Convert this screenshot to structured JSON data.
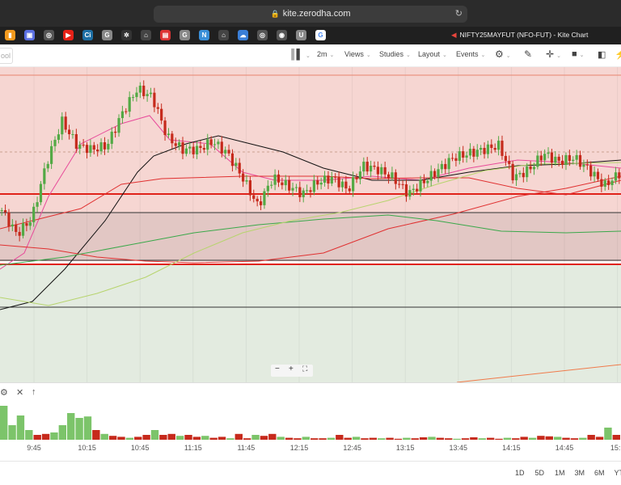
{
  "browser": {
    "url": "kite.zerodha.com",
    "tab_title": "NIFTY25MAYFUT (NFO-FUT) - Kite Chart",
    "favicons": [
      {
        "name": "analytics-icon",
        "color": "#f29a1e",
        "glyph": "▮"
      },
      {
        "name": "app-icon",
        "color": "#5b6fe0",
        "glyph": "▣"
      },
      {
        "name": "camera-icon",
        "color": "#555",
        "glyph": "◎"
      },
      {
        "name": "youtube-icon",
        "color": "#e62117",
        "glyph": "▶"
      },
      {
        "name": "ci-icon",
        "color": "#1d6fa5",
        "glyph": "Ci"
      },
      {
        "name": "g-icon",
        "color": "#888",
        "glyph": "G"
      },
      {
        "name": "dots-icon",
        "color": "#333",
        "glyph": "✲"
      },
      {
        "name": "shop-icon",
        "color": "#444",
        "glyph": "⌂"
      },
      {
        "name": "calendar-icon",
        "color": "#d33",
        "glyph": "▤"
      },
      {
        "name": "g2-icon",
        "color": "#888",
        "glyph": "G"
      },
      {
        "name": "n-icon",
        "color": "#3a8fd8",
        "glyph": "N"
      },
      {
        "name": "shop2-icon",
        "color": "#444",
        "glyph": "⌂"
      },
      {
        "name": "cloud-icon",
        "color": "#3a7fd8",
        "glyph": "☁"
      },
      {
        "name": "camera2-icon",
        "color": "#555",
        "glyph": "◎"
      },
      {
        "name": "record-icon",
        "color": "#555",
        "glyph": "◉"
      },
      {
        "name": "u-icon",
        "color": "#888",
        "glyph": "U"
      },
      {
        "name": "google-icon",
        "color": "#fff",
        "glyph": "G"
      }
    ]
  },
  "toolbar": {
    "search_placeholder": "ool",
    "interval": "2m",
    "views": "Views",
    "studies": "Studies",
    "layout": "Layout",
    "events": "Events"
  },
  "chart_data": {
    "type": "candlestick",
    "ylim": [
      24780,
      25000
    ],
    "price_path": [
      24840,
      24810,
      24830,
      24900,
      24950,
      24920,
      24915,
      24920,
      24960,
      24990,
      24980,
      24930,
      24915,
      24915,
      24925,
      24910,
      24880,
      24845,
      24880,
      24870,
      24860,
      24875,
      24880,
      24865,
      24895,
      24890,
      24880,
      24860,
      24875,
      24890,
      24905,
      24910,
      24915,
      24920,
      24880,
      24890,
      24910,
      24900,
      24905,
      24890,
      24870,
      24885
    ],
    "volume": [
      70,
      30,
      50,
      20,
      10,
      12,
      15,
      30,
      55,
      45,
      48,
      20,
      12,
      8,
      6,
      4,
      6,
      10,
      20,
      10,
      12,
      8,
      10,
      6,
      8,
      4,
      6,
      3,
      12,
      3,
      10,
      8,
      12,
      6,
      4,
      3,
      6,
      3,
      3,
      4,
      10,
      4,
      6,
      3,
      4,
      3,
      4,
      2,
      4,
      3,
      5,
      6,
      4,
      3,
      2,
      3,
      5,
      3,
      4,
      2,
      4,
      3,
      6,
      4,
      8,
      7,
      6,
      4,
      3,
      4,
      10,
      6,
      25,
      10
    ],
    "x_ticks": [
      "9:45",
      "10:15",
      "10:45",
      "11:15",
      "11:45",
      "12:15",
      "12:45",
      "13:15",
      "13:45",
      "14:15",
      "14:45",
      "15:1"
    ],
    "colors": {
      "up": "#53a945",
      "down": "#c62a1c",
      "up_volume": "#7cc46a",
      "down_volume": "#c62a1c"
    }
  },
  "volume_panel": {
    "close": "✕",
    "up": "↑"
  },
  "zoom_controls": {
    "minus": "−",
    "plus": "+",
    "fullscreen": "⛶"
  },
  "ranges": [
    "1D",
    "5D",
    "1M",
    "3M",
    "6M",
    "YT"
  ]
}
